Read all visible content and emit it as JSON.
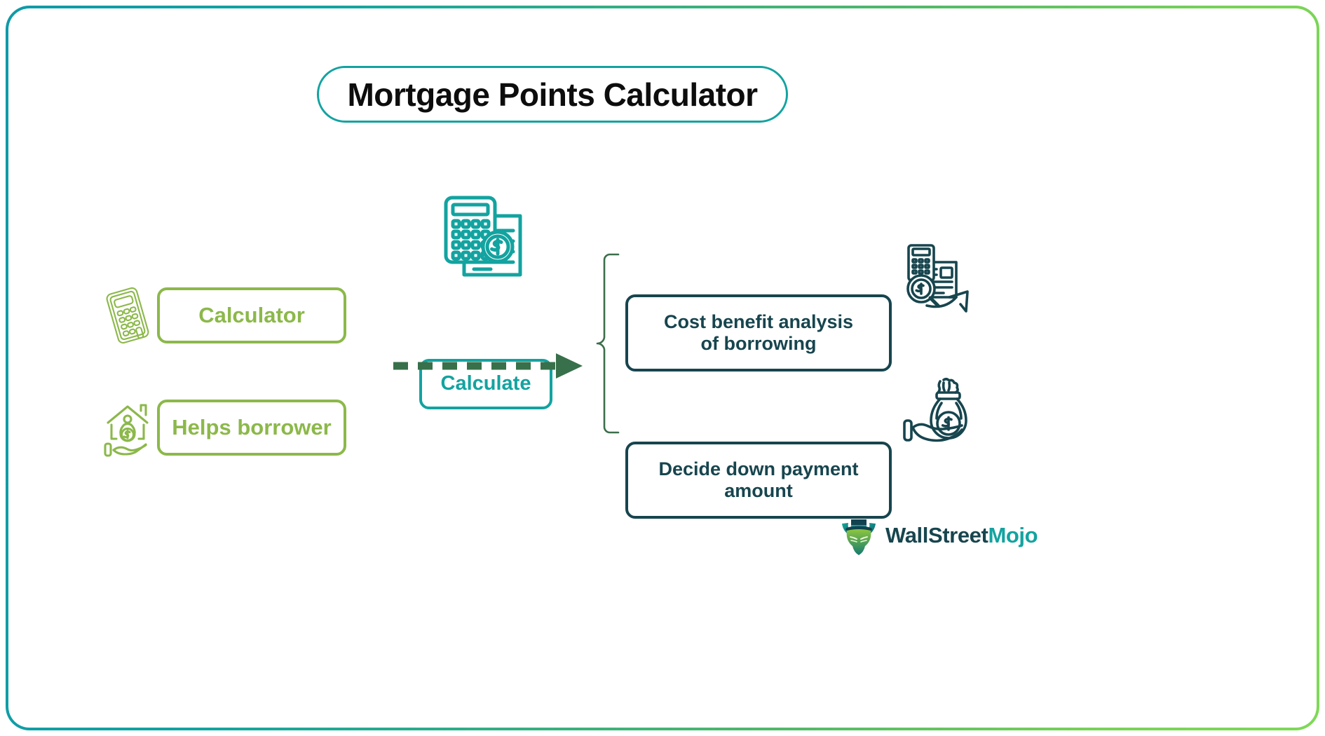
{
  "title": {
    "text": "Mortgage Points Calculator"
  },
  "colors": {
    "teal": "#13a3a0",
    "green": "#8cb84a",
    "navy": "#17454e",
    "arrow_green": "#37704a",
    "bright_green": "#7ed957"
  },
  "inputs": [
    {
      "label": "Calculator",
      "icon": "calculator-icon"
    },
    {
      "label": "Helps borrower",
      "icon": "house-money-icon"
    }
  ],
  "process": {
    "label": "Calculate",
    "icon": "calculator-document-dollar-icon",
    "arrow": "dashed-arrow-right-icon"
  },
  "outputs": [
    {
      "label": "Cost benefit analysis of borrowing",
      "line1": "Cost benefit analysis",
      "line2": "of borrowing",
      "icon": "cost-analysis-icon"
    },
    {
      "label": "Decide down payment amount",
      "line1": "Decide down payment",
      "line2": "amount",
      "icon": "money-bag-hand-icon"
    }
  ],
  "brand": {
    "name": "WallStreetMojo",
    "part1": "WallStreet",
    "part2": "Mojo",
    "mark": "bull-head-tophat-logo"
  }
}
